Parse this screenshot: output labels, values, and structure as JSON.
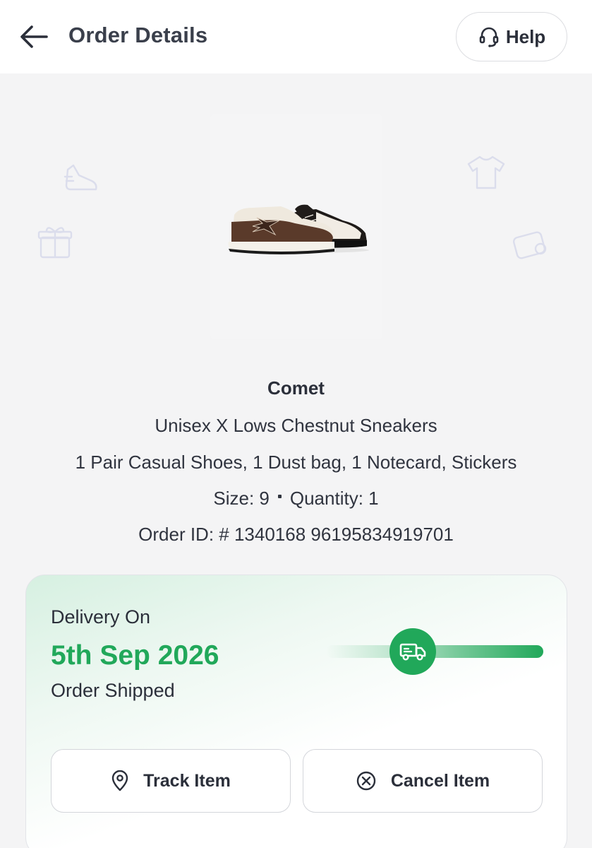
{
  "header": {
    "title": "Order Details",
    "help_label": "Help"
  },
  "product": {
    "brand": "Comet",
    "name": "Unisex X Lows Chestnut Sneakers",
    "contents": "1 Pair Casual Shoes, 1 Dust bag, 1 Notecard, Stickers",
    "size_label": "Size: 9",
    "quantity_label": "Quantity: 1",
    "order_id": "Order ID: # 1340168 96195834919701"
  },
  "delivery": {
    "label": "Delivery On",
    "date": "5th Sep 2026",
    "status": "Order Shipped",
    "progress": 0.4
  },
  "actions": {
    "track_label": "Track Item",
    "cancel_label": "Cancel Item"
  },
  "colors": {
    "accent": "#21a85a",
    "text": "#2b2f3a",
    "background": "#f4f4f5"
  },
  "icons": [
    "back-arrow-icon",
    "headset-icon",
    "truck-icon",
    "location-pin-icon",
    "cancel-circle-icon"
  ]
}
